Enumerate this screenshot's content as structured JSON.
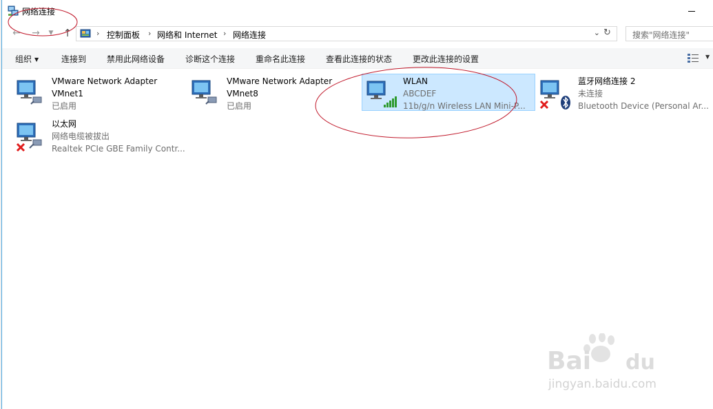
{
  "window": {
    "title": "网络连接"
  },
  "address": {
    "crumbs": [
      "控制面板",
      "网络和 Internet",
      "网络连接"
    ],
    "search_placeholder": "搜索\"网络连接\""
  },
  "toolbar": {
    "organize": "组织",
    "connect_to": "连接到",
    "disable_device": "禁用此网络设备",
    "diagnose": "诊断这个连接",
    "rename": "重命名此连接",
    "view_status": "查看此连接的状态",
    "change_settings": "更改此连接的设置"
  },
  "connections": [
    {
      "name": "VMware Network Adapter",
      "line2": "VMnet1",
      "line3": "已启用",
      "status": "enabled"
    },
    {
      "name": "VMware Network Adapter",
      "line2": "VMnet8",
      "line3": "已启用",
      "status": "enabled"
    },
    {
      "name": "WLAN",
      "line2": "ABCDEF",
      "line3": "11b/g/n  Wireless LAN Mini-P...",
      "status": "wireless",
      "selected": true
    },
    {
      "name": "蓝牙网络连接 2",
      "line2": "未连接",
      "line3": "Bluetooth Device (Personal Ar...",
      "status": "disconnected-bluetooth"
    },
    {
      "name": "以太网",
      "line2": "网络电缆被拔出",
      "line3": "Realtek PCIe GBE Family Contr...",
      "status": "unplugged"
    }
  ],
  "watermark": {
    "text": "jingyan.baidu.com"
  },
  "colors": {
    "selection": "#cce8ff",
    "annotation": "#c0182a",
    "accent": "#4ba5dc"
  }
}
